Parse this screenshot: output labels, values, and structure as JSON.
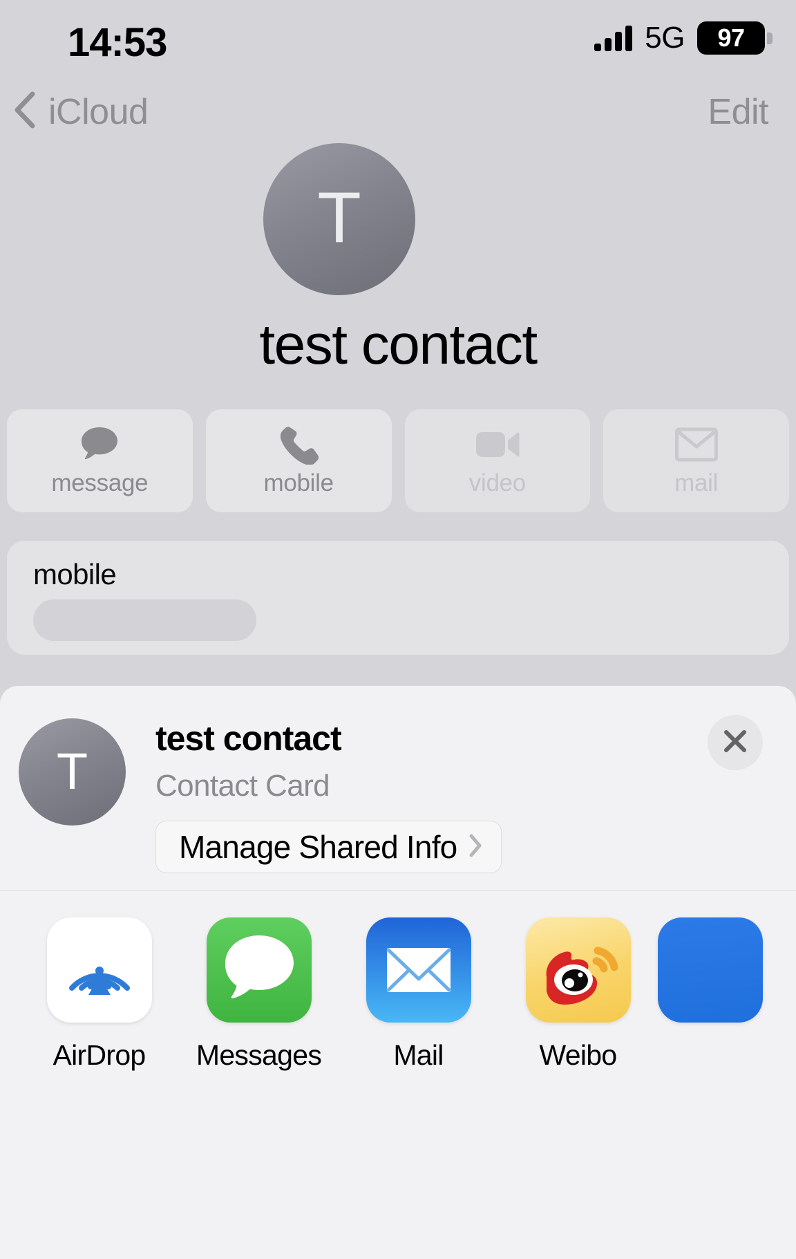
{
  "status_bar": {
    "time": "14:53",
    "network": "5G",
    "battery_percent": "97",
    "signal_icon": "cellular-signal-icon",
    "battery_icon": "battery-icon"
  },
  "nav_bar": {
    "back_label": "iCloud",
    "back_icon": "chevron-left-icon",
    "edit_label": "Edit"
  },
  "contact": {
    "name": "test contact",
    "avatar_initial": "T",
    "avatar_color": "#84848f"
  },
  "quick_actions": [
    {
      "label": "message",
      "icon": "message-bubble-icon",
      "enabled": true
    },
    {
      "label": "mobile",
      "icon": "phone-handset-icon",
      "enabled": true
    },
    {
      "label": "video",
      "icon": "video-camera-icon",
      "enabled": false
    },
    {
      "label": "mail",
      "icon": "envelope-icon",
      "enabled": false
    }
  ],
  "info_card": {
    "label": "mobile",
    "value": "",
    "value_redacted": true
  },
  "share_sheet": {
    "title": "test contact",
    "subtitle": "Contact Card",
    "avatar_initial": "T",
    "manage_button_label": "Manage Shared Info",
    "manage_button_icon": "chevron-right-icon",
    "close_icon": "close-x-icon",
    "apps": [
      {
        "label": "AirDrop",
        "icon": "airdrop-icon",
        "bg": "#ffffff",
        "accent": "#2f7cd8"
      },
      {
        "label": "Messages",
        "icon": "messages-icon",
        "bg": "#5ac85a",
        "accent": "#ffffff"
      },
      {
        "label": "Mail",
        "icon": "mail-icon",
        "bg": "#2f7cd8",
        "accent": "#ffffff"
      },
      {
        "label": "Weibo",
        "icon": "weibo-icon",
        "bg": "#f6d46a",
        "accent": "#d82626"
      }
    ],
    "partial_app": {
      "label": "",
      "icon": "app-icon-partial",
      "bg": "#2b7ae8"
    }
  },
  "colors": {
    "page_background": "#d4d4d9",
    "sheet_background": "#f2f2f4",
    "card_background": "#e3e3e6",
    "quick_action_background": "#e5e5e7",
    "secondary_text": "#8e8e93",
    "disabled_text": "#c4c4c9"
  }
}
